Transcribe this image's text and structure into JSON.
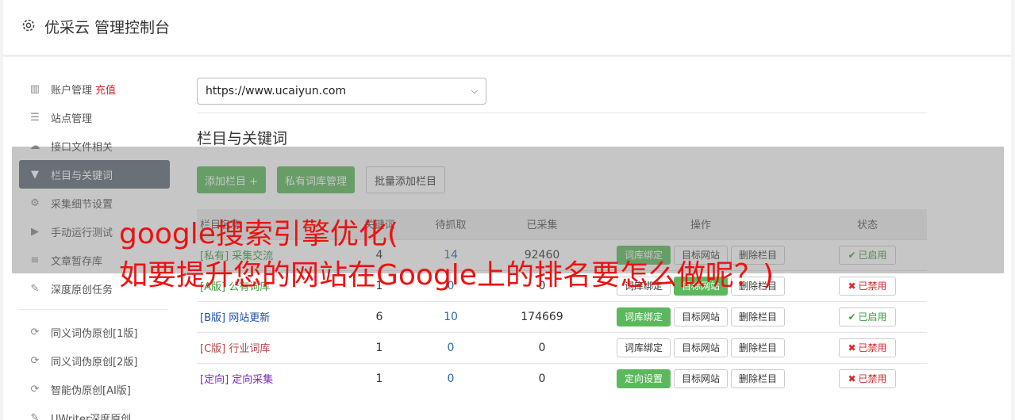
{
  "header": {
    "title": "优采云 管理控制台"
  },
  "sidebar": {
    "items": [
      {
        "icon": "bar-chart-icon",
        "glyph": "▥",
        "label": "账户管理",
        "badge": "充值"
      },
      {
        "icon": "server-icon",
        "glyph": "☰",
        "label": "站点管理"
      },
      {
        "icon": "cloud-upload-icon",
        "glyph": "☁",
        "label": "接口文件相关"
      },
      {
        "icon": "filter-icon",
        "glyph": "▼",
        "label": "栏目与关键词"
      },
      {
        "icon": "cogs-icon",
        "glyph": "⚙",
        "label": "采集细节设置"
      },
      {
        "icon": "play-icon",
        "glyph": "▶",
        "label": "手动运行测试"
      },
      {
        "icon": "database-icon",
        "glyph": "≡",
        "label": "文章暂存库"
      },
      {
        "icon": "edit-icon",
        "glyph": "✎",
        "label": "深度原创任务"
      }
    ],
    "items2": [
      {
        "icon": "refresh-icon",
        "glyph": "⟳",
        "label": "同义词伪原创[1版]"
      },
      {
        "icon": "refresh-icon",
        "glyph": "⟳",
        "label": "同义词伪原创[2版]"
      },
      {
        "icon": "refresh-icon",
        "glyph": "⟳",
        "label": "智能伪原创[AI版]"
      },
      {
        "icon": "edit-icon",
        "glyph": "✎",
        "label": "UWriter深度原创"
      }
    ]
  },
  "site_select": {
    "value": "https://www.ucaiyun.com"
  },
  "section": {
    "title": "栏目与关键词"
  },
  "buttons": {
    "add": "添加栏目 +",
    "private": "私有词库管理",
    "batch": "批量添加栏目"
  },
  "table": {
    "headers": {
      "name": "栏目名称",
      "kw": "关键词",
      "pending": "待抓取",
      "collected": "已采集",
      "ops": "操作",
      "status": "状态"
    },
    "rows": [
      {
        "tag": "[私有]",
        "name": "采集交流",
        "kw": "4",
        "pending": "14",
        "collected": "92460",
        "bind": "词库绑定",
        "target": "目标网站",
        "del": "删除栏目",
        "status": "已启用"
      },
      {
        "tag": "[A版]",
        "name": "公有词库",
        "kw": "1",
        "pending": "0",
        "collected": "0",
        "bind": "词库绑定",
        "target": "目标网站",
        "del": "删除栏目",
        "status": "已禁用"
      },
      {
        "tag": "[B版]",
        "name": "网站更新",
        "kw": "6",
        "pending": "10",
        "collected": "174669",
        "bind": "词库绑定",
        "target": "目标网站",
        "del": "删除栏目",
        "status": "已启用"
      },
      {
        "tag": "[C版]",
        "name": "行业词库",
        "kw": "1",
        "pending": "0",
        "collected": "0",
        "bind": "词库绑定",
        "target": "目标网站",
        "del": "删除栏目",
        "status": "已禁用"
      },
      {
        "tag": "[定向]",
        "name": "定向采集",
        "kw": "1",
        "pending": "0",
        "collected": "0",
        "bind": "定向设置",
        "target": "目标网站",
        "del": "删除栏目",
        "status": "已禁用"
      }
    ]
  },
  "overlay": {
    "line1": "google搜索引擎优化(",
    "line2": "如要提升您的网站在Google上的排名要怎么做呢？)"
  }
}
